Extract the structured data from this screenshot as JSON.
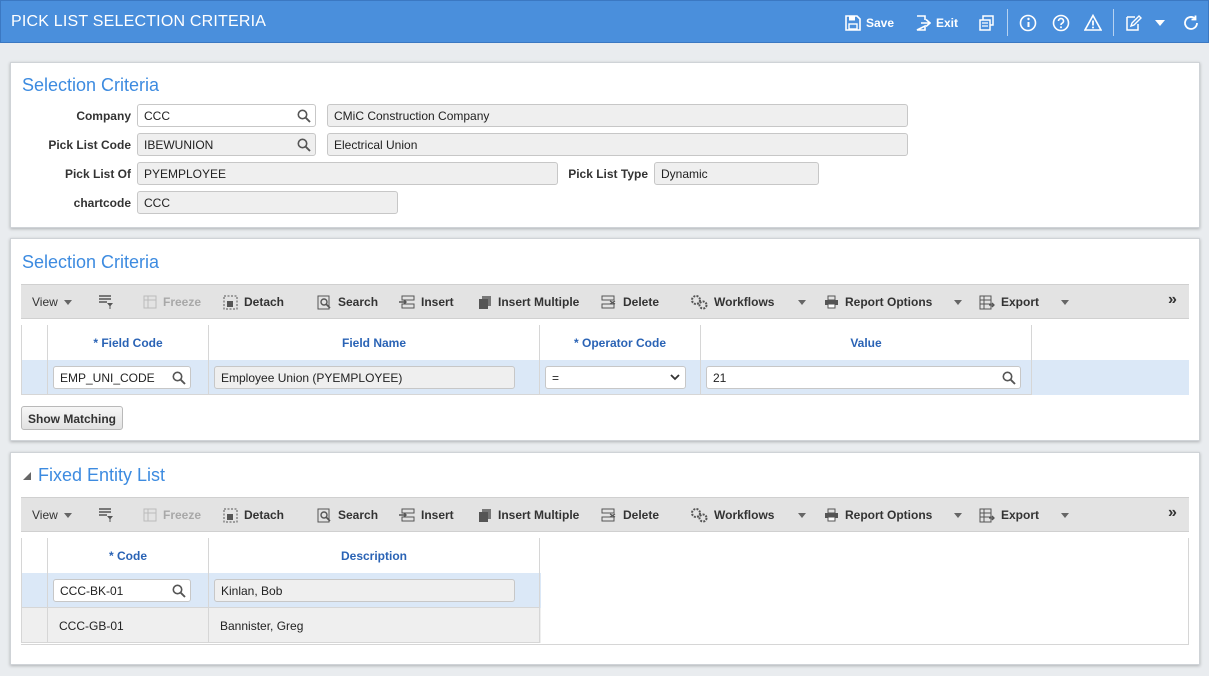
{
  "app": {
    "title": "PICK LIST SELECTION CRITERIA",
    "save_label": "Save",
    "exit_label": "Exit"
  },
  "header_panel": {
    "title": "Selection Criteria",
    "company_label": "Company",
    "company_value": "CCC",
    "company_name": "CMiC Construction Company",
    "picklist_code_label": "Pick List Code",
    "picklist_code_value": "IBEWUNION",
    "picklist_code_desc": "Electrical Union",
    "picklist_of_label": "Pick List Of",
    "picklist_of_value": "PYEMPLOYEE",
    "picklist_type_label": "Pick List Type",
    "picklist_type_value": "Dynamic",
    "chartcode_label": "chartcode",
    "chartcode_value": "CCC"
  },
  "toolbar": {
    "view": "View",
    "freeze": "Freeze",
    "detach": "Detach",
    "search": "Search",
    "insert": "Insert",
    "insert_multiple": "Insert Multiple",
    "delete": "Delete",
    "workflows": "Workflows",
    "report_options": "Report Options",
    "export": "Export"
  },
  "criteria_panel": {
    "title": "Selection Criteria",
    "columns": [
      "* Field Code",
      "Field Name",
      "* Operator Code",
      "Value"
    ],
    "rows": [
      {
        "field_code": "EMP_UNI_CODE",
        "field_name": "Employee Union (PYEMPLOYEE)",
        "operator": "=",
        "value": "21"
      }
    ],
    "show_matching": "Show Matching"
  },
  "entity_panel": {
    "title": "Fixed Entity List",
    "columns": [
      "* Code",
      "Description"
    ],
    "rows": [
      {
        "code": "CCC-BK-01",
        "description": "Kinlan, Bob"
      },
      {
        "code": "CCC-GB-01",
        "description": "Bannister, Greg"
      }
    ]
  },
  "colors": {
    "titlebar": "#4a8fdc",
    "panel_title": "#3d8be0",
    "column_header": "#2a63b5",
    "selected_row": "#dbe8f7"
  }
}
